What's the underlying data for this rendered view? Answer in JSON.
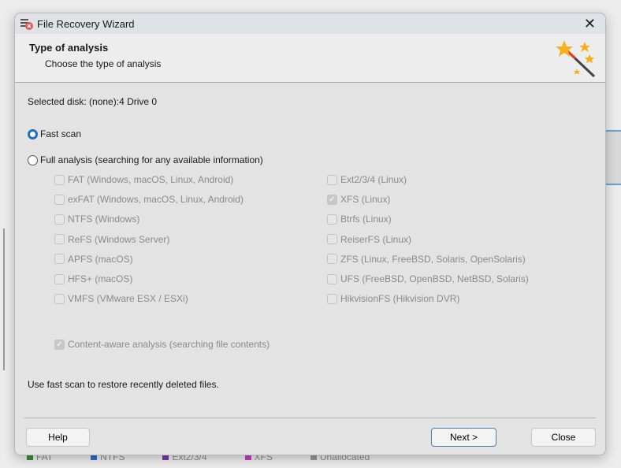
{
  "window": {
    "title": "File Recovery Wizard",
    "close_icon": "close-icon"
  },
  "header": {
    "title": "Type of analysis",
    "subtitle": "Choose the type of analysis",
    "icon": "magic-wand-icon"
  },
  "selected_disk": "Selected disk: (none):4 Drive 0",
  "scan_types": [
    {
      "label": "Fast scan",
      "selected": true
    },
    {
      "label": "Full analysis (searching for any available information)",
      "selected": false
    }
  ],
  "filesystems_left": [
    {
      "label": "FAT (Windows, macOS, Linux, Android)",
      "checked": false
    },
    {
      "label": "exFAT (Windows, macOS, Linux, Android)",
      "checked": false
    },
    {
      "label": "NTFS (Windows)",
      "checked": false
    },
    {
      "label": "ReFS (Windows Server)",
      "checked": false
    },
    {
      "label": "APFS (macOS)",
      "checked": false
    },
    {
      "label": "HFS+ (macOS)",
      "checked": false
    },
    {
      "label": "VMFS (VMware ESX / ESXi)",
      "checked": false
    }
  ],
  "filesystems_right": [
    {
      "label": "Ext2/3/4 (Linux)",
      "checked": false
    },
    {
      "label": "XFS (Linux)",
      "checked": true
    },
    {
      "label": "Btrfs (Linux)",
      "checked": false
    },
    {
      "label": "ReiserFS (Linux)",
      "checked": false
    },
    {
      "label": "ZFS (Linux, FreeBSD, Solaris, OpenSolaris)",
      "checked": false
    },
    {
      "label": "UFS (FreeBSD, OpenBSD, NetBSD, Solaris)",
      "checked": false
    },
    {
      "label": "HikvisionFS (Hikvision DVR)",
      "checked": false
    }
  ],
  "content_aware": {
    "label": "Content-aware analysis (searching file contents)",
    "checked": true
  },
  "hint": "Use fast scan to restore recently deleted files.",
  "buttons": {
    "help": "Help",
    "next": "Next >",
    "close": "Close"
  },
  "background_legend": [
    {
      "label": "FAT",
      "color": "#3a8a3a"
    },
    {
      "label": "NTFS",
      "color": "#2a6fcc"
    },
    {
      "label": "Ext2/3/4",
      "color": "#7a3aa8"
    },
    {
      "label": "XFS",
      "color": "#c040c0"
    },
    {
      "label": "Unallocated",
      "color": "#999999"
    }
  ]
}
